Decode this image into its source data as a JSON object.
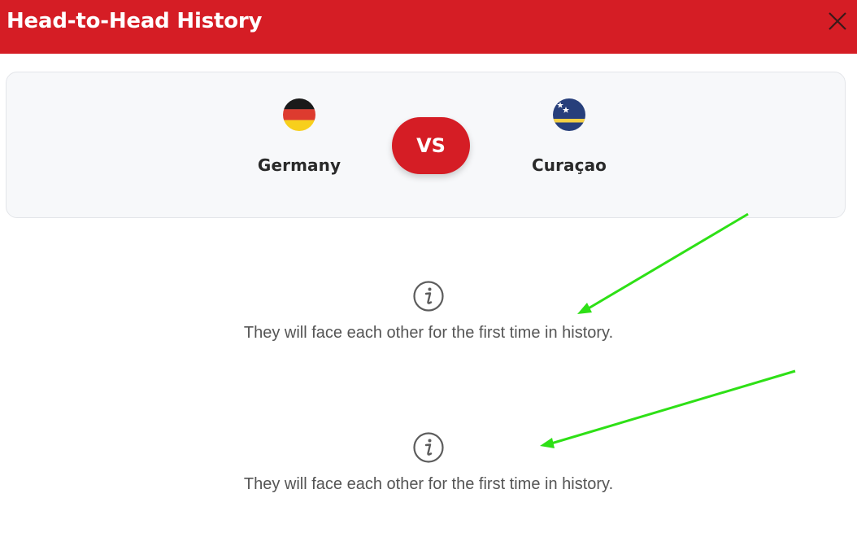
{
  "header": {
    "title": "Head-to-Head History",
    "close_icon": "close-icon",
    "background_color": "#d51d25"
  },
  "match": {
    "home_team": {
      "name": "Germany",
      "flag_icon": "germany-flag-icon"
    },
    "away_team": {
      "name": "Curaçao",
      "flag_icon": "curacao-flag-icon"
    },
    "vs_label": "VS"
  },
  "messages": [
    {
      "icon": "info-icon",
      "text": "They will face each other for the first time in history."
    },
    {
      "icon": "info-icon",
      "text": "They will face each other for the first time in history."
    }
  ],
  "annotations": {
    "arrow_color": "#2ee016"
  }
}
